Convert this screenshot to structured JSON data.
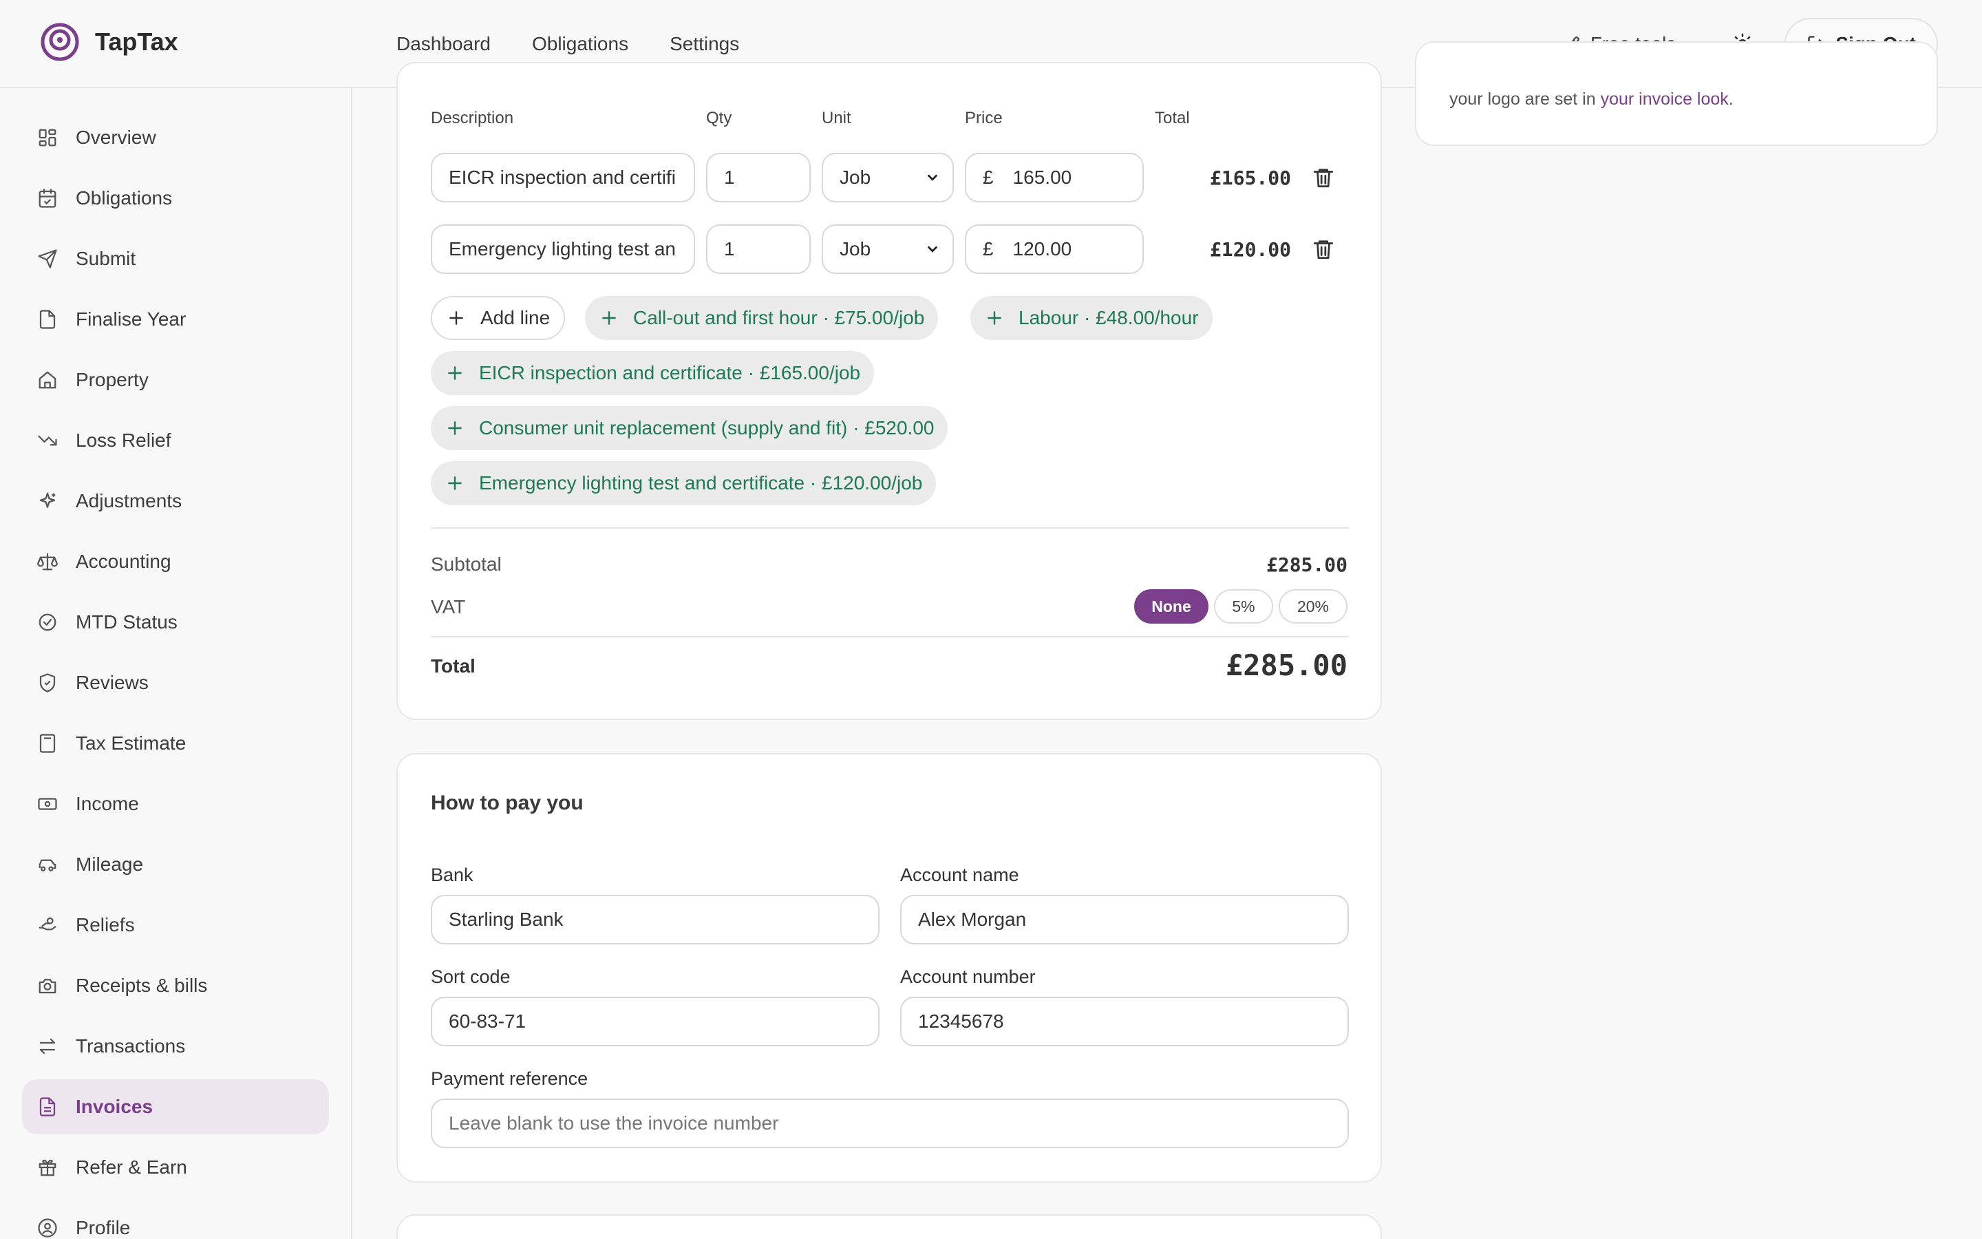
{
  "brand": {
    "name": "TapTax"
  },
  "topnav": [
    "Dashboard",
    "Obligations",
    "Settings"
  ],
  "header": {
    "free_tools": "Free tools",
    "sign_out": "Sign Out"
  },
  "sidebar": {
    "items": [
      {
        "label": "Overview",
        "icon": "grid-icon"
      },
      {
        "label": "Obligations",
        "icon": "calendar-check-icon"
      },
      {
        "label": "Submit",
        "icon": "send-icon"
      },
      {
        "label": "Finalise Year",
        "icon": "file-check-icon"
      },
      {
        "label": "Property",
        "icon": "home-icon"
      },
      {
        "label": "Loss Relief",
        "icon": "trending-down-icon"
      },
      {
        "label": "Adjustments",
        "icon": "sparkle-icon"
      },
      {
        "label": "Accounting",
        "icon": "scale-icon"
      },
      {
        "label": "MTD Status",
        "icon": "check-circle-icon"
      },
      {
        "label": "Reviews",
        "icon": "shield-check-icon"
      },
      {
        "label": "Tax Estimate",
        "icon": "calculator-icon"
      },
      {
        "label": "Income",
        "icon": "banknote-icon"
      },
      {
        "label": "Mileage",
        "icon": "car-icon"
      },
      {
        "label": "Reliefs",
        "icon": "hand-coins-icon"
      },
      {
        "label": "Receipts & bills",
        "icon": "camera-icon"
      },
      {
        "label": "Transactions",
        "icon": "arrows-swap-icon"
      },
      {
        "label": "Invoices",
        "icon": "file-text-icon",
        "active": true
      },
      {
        "label": "Refer & Earn",
        "icon": "gift-icon"
      },
      {
        "label": "Profile",
        "icon": "user-circle-icon"
      }
    ]
  },
  "line_items": {
    "headers": {
      "description": "Description",
      "qty": "Qty",
      "unit": "Unit",
      "price": "Price",
      "total": "Total"
    },
    "rows": [
      {
        "description": "EICR inspection and certifi",
        "qty": "1",
        "unit": "Job",
        "currency": "£",
        "price": "165.00",
        "total": "£165.00"
      },
      {
        "description": "Emergency lighting test an",
        "qty": "1",
        "unit": "Job",
        "currency": "£",
        "price": "120.00",
        "total": "£120.00"
      }
    ],
    "add_line": "Add line",
    "presets": [
      "Call-out and first hour · £75.00/job",
      "Labour · £48.00/hour",
      "EICR inspection and certificate · £165.00/job",
      "Consumer unit replacement (supply and fit) · £520.00",
      "Emergency lighting test and certificate · £120.00/job"
    ]
  },
  "summary": {
    "subtotal_label": "Subtotal",
    "subtotal": "£285.00",
    "vat_label": "VAT",
    "vat_options": [
      "None",
      "5%",
      "20%"
    ],
    "vat_selected": "None",
    "total_label": "Total",
    "total": "£285.00"
  },
  "payment": {
    "title": "How to pay you",
    "bank_label": "Bank",
    "bank": "Starling Bank",
    "account_name_label": "Account name",
    "account_name": "Alex Morgan",
    "sort_code_label": "Sort code",
    "sort_code": "60-83-71",
    "account_number_label": "Account number",
    "account_number": "12345678",
    "reference_label": "Payment reference",
    "reference_placeholder": "Leave blank to use the invoice number"
  },
  "side_note": {
    "text": "your logo are set in ",
    "link": "your invoice look",
    "suffix": "."
  },
  "colors": {
    "accent": "#7a3e8a",
    "preset_text": "#1d7a55"
  }
}
